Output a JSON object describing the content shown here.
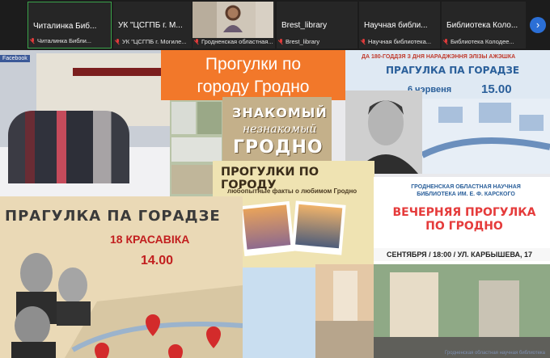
{
  "participants": [
    {
      "name": "Читалинка Биб...",
      "label": "Читалинка Библи...",
      "active": true
    },
    {
      "name": "УК \"ЦСГПБ г. М...",
      "label": "УК \"ЦСГПБ г. Могиле..."
    },
    {
      "name": "",
      "label": "Гродненская областная..."
    },
    {
      "name": "Brest_library",
      "label": "Brest_library"
    },
    {
      "name": "Научная библи...",
      "label": "Научная библиотека..."
    },
    {
      "name": "Библиотека Коло...",
      "label": "Библиотека Колодее..."
    }
  ],
  "share": {
    "facebook": "Facebook",
    "main_title_1": "Прогулки по",
    "main_title_2": "городу Гродно",
    "right_top": "ДА 180-ГОДДЗЯ З ДНЯ НАРАДЖЭННЯ ЭЛІЗЫ АЖЭШКА",
    "right_title": "ПРАГУЛКА ПА ГОРАДЗЕ",
    "right_date": "6 чэрвеня",
    "right_time": "15.00",
    "znak_1": "ЗНАКОМЫЙ",
    "znak_2": "незнакомый",
    "znak_3": "ГРОДНО",
    "prog_title": "ПРОГУЛКИ ПО ГОРОДУ",
    "prog_sub": "любопытные факты о любимом Гродно",
    "prag_title": "ПРАГУЛКА ПА ГОРАДЗЕ",
    "prag_date": "18 КРАСАВІКА",
    "prag_time": "14.00",
    "vech_lib": "ГРОДНЕНСКАЯ ОБЛАСТНАЯ НАУЧНАЯ БИБЛИОТЕКА ИМ. Е. Ф. КАРСКОГО",
    "vech_title_1": "ВЕЧЕРНЯЯ ПРОГУЛКА",
    "vech_title_2": "ПО ГРОДНО",
    "vech_info": "СЕНТЯБРЯ / 18:00 / УЛ. КАРБЫШЕВА, 17",
    "watermark": "Гродненская областная научная библиотека"
  },
  "colors": {
    "accent": "#f2782a",
    "active_border": "#3aa24a",
    "next_button": "#2b6fd6"
  }
}
